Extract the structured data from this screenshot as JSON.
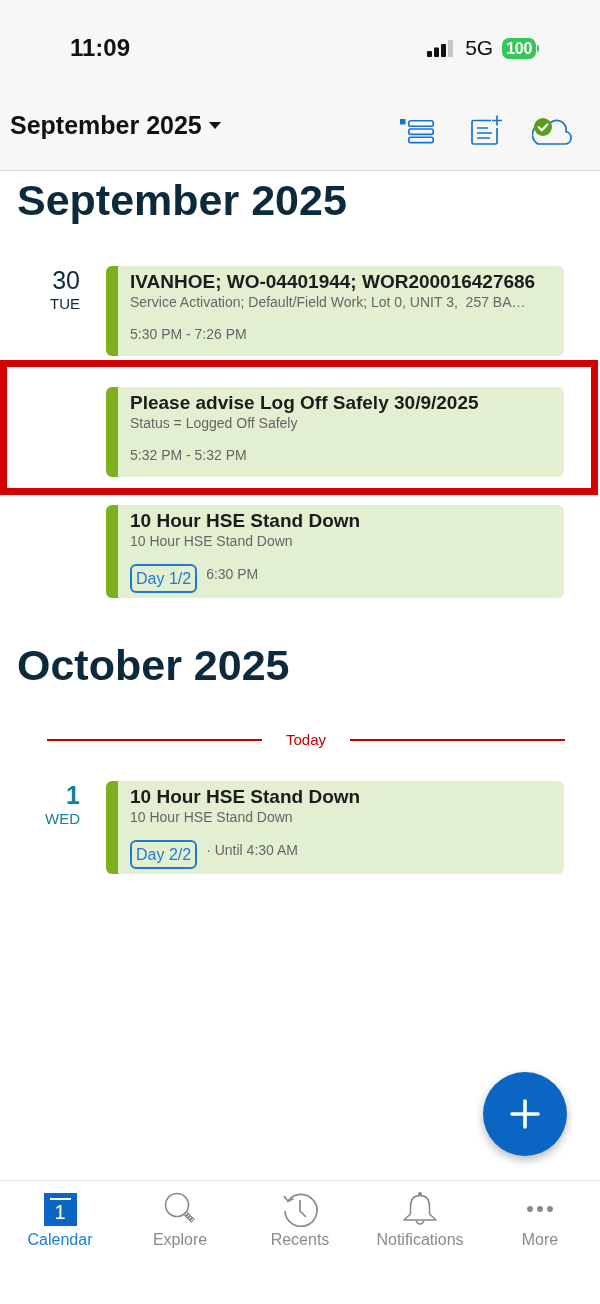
{
  "status_bar": {
    "time": "11:09",
    "network": "5G",
    "battery": "100"
  },
  "toolbar": {
    "title": "September 2025"
  },
  "sections": [
    {
      "heading": "September 2025",
      "days": [
        {
          "day": "30",
          "weekday": "TUE",
          "today": false,
          "events": [
            {
              "title": "IVANHOE; WO-04401944; WOR200016427686",
              "details": "Service Activation; Default/Field Work; Lot 0, UNIT 3,  257 BA…",
              "time": "5:30 PM - 7:26 PM",
              "highlighted": false
            },
            {
              "title": "Please advise Log Off Safely 30/9/2025",
              "details": "Status = Logged Off Safely",
              "time": "5:32 PM - 5:32 PM",
              "highlighted": true
            },
            {
              "title": "10 Hour HSE Stand Down",
              "details": "10 Hour HSE Stand Down",
              "badge": "Day 1/2",
              "time": "6:30 PM",
              "highlighted": false
            }
          ]
        }
      ]
    },
    {
      "heading": "October 2025",
      "days": [
        {
          "divider": "Today",
          "day": "1",
          "weekday": "WED",
          "today": true,
          "events": [
            {
              "title": "10 Hour HSE Stand Down",
              "details": "10 Hour HSE Stand Down",
              "badge": "Day 2/2",
              "time": "· Until 4:30 AM",
              "highlighted": false
            }
          ]
        }
      ]
    }
  ],
  "tab_bar": [
    {
      "label": "Calendar",
      "icon_text": "1",
      "selected": true
    },
    {
      "label": "Explore",
      "selected": false
    },
    {
      "label": "Recents",
      "selected": false
    },
    {
      "label": "Notifications",
      "selected": false
    },
    {
      "label": "More",
      "selected": false
    }
  ]
}
